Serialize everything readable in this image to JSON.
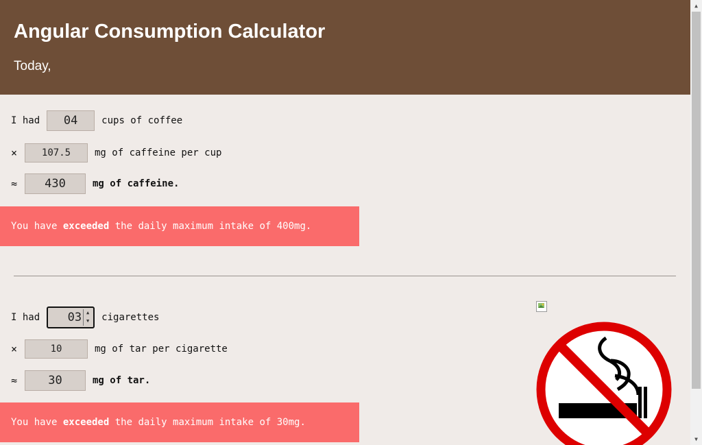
{
  "header": {
    "title": "Angular Consumption Calculator",
    "subtitle": "Today,"
  },
  "coffee": {
    "had_label": "I had",
    "cups_value": "04",
    "cups_label": "cups of coffee",
    "times_symbol": "×",
    "per_cup_value": "107.5",
    "per_cup_label": "mg of caffeine per cup",
    "approx_symbol": "≈",
    "total_value": "430",
    "total_label": "mg of caffeine.",
    "alert_prefix": "You have ",
    "alert_strong": "exceeded",
    "alert_suffix": " the daily maximum intake of 400mg."
  },
  "cigarettes": {
    "had_label": "I had",
    "count_value": "03",
    "count_label": "cigarettes",
    "times_symbol": "×",
    "per_cig_value": "10",
    "per_cig_label": "mg of tar per cigarette",
    "approx_symbol": "≈",
    "total_value": "30",
    "total_label": "mg of tar.",
    "alert_prefix": "You have ",
    "alert_strong": "exceeded",
    "alert_suffix": " the daily maximum intake of 30mg."
  },
  "images": {
    "broken_image_icon": "broken-image-icon",
    "no_smoking_icon": "no-smoking-icon"
  },
  "colors": {
    "header_bg": "#6e4e37",
    "page_bg": "#f0ebe8",
    "alert_bg": "#fa6b6b",
    "sign_red": "#dd0000"
  }
}
